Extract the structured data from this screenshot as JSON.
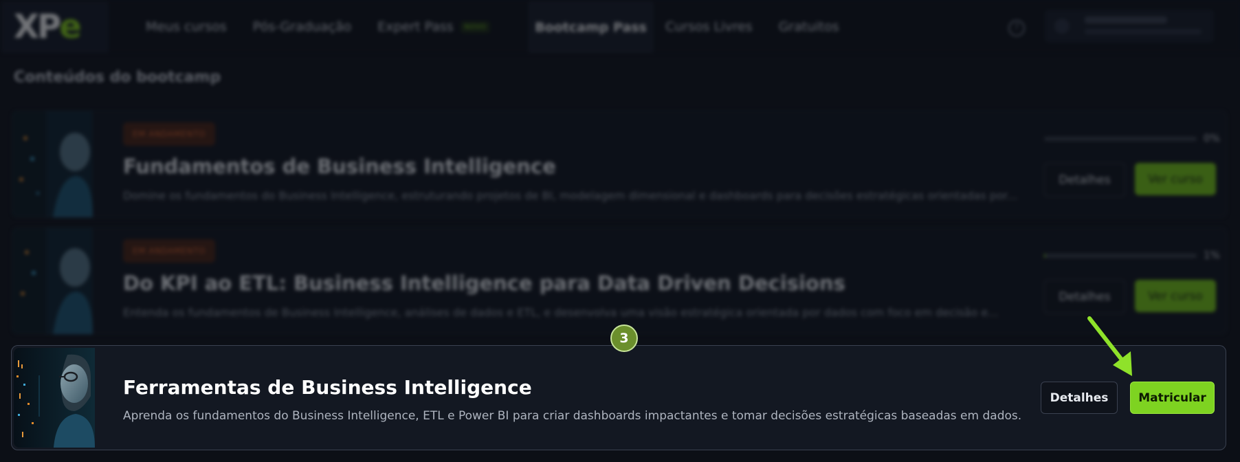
{
  "header": {
    "logo_text": "XP",
    "logo_accent": "e",
    "nav": [
      {
        "label": "Meus cursos"
      },
      {
        "label": "Pós-Graduação"
      },
      {
        "label": "Expert Pass",
        "badge": "NOVO"
      }
    ],
    "active_tab": "Bootcamp Pass",
    "nav_after": [
      {
        "label": "Cursos Livres"
      },
      {
        "label": "Gratuitos"
      }
    ],
    "help_icon": "question-circle-icon"
  },
  "section_title": "Conteúdos do bootcamp",
  "courses": [
    {
      "status": "EM ANDAMENTO",
      "title": "Fundamentos de Business Intelligence",
      "description": "Domine os fundamentos do Business Intelligence, estruturando projetos de BI, modelagem dimensional e dashboards para decisões estratégicas orientadas por...",
      "progress_percent": 0,
      "progress_label": "0%",
      "details_label": "Detalhes",
      "action_label": "Ver curso"
    },
    {
      "status": "EM ANDAMENTO",
      "title": "Do KPI ao ETL: Business Intelligence para Data Driven Decisions",
      "description": "Entenda os fundamentos de Business Intelligence, análises de dados e ETL, e desenvolva uma visão estratégica orientada por dados com foco em decisão e...",
      "progress_percent": 1,
      "progress_label": "1%",
      "details_label": "Detalhes",
      "action_label": "Ver curso"
    }
  ],
  "focused_course": {
    "title": "Ferramentas de Business Intelligence",
    "description": "Aprenda os fundamentos do Business Intelligence, ETL e Power BI para criar dashboards impactantes e tomar decisões estratégicas baseadas em dados.",
    "details_label": "Detalhes",
    "action_label": "Matricular"
  },
  "step_number": "3",
  "colors": {
    "background": "#0c0f16",
    "accent_green": "#7ed321",
    "status_orange": "#e3632b",
    "step_badge": "#6b8f2c"
  }
}
